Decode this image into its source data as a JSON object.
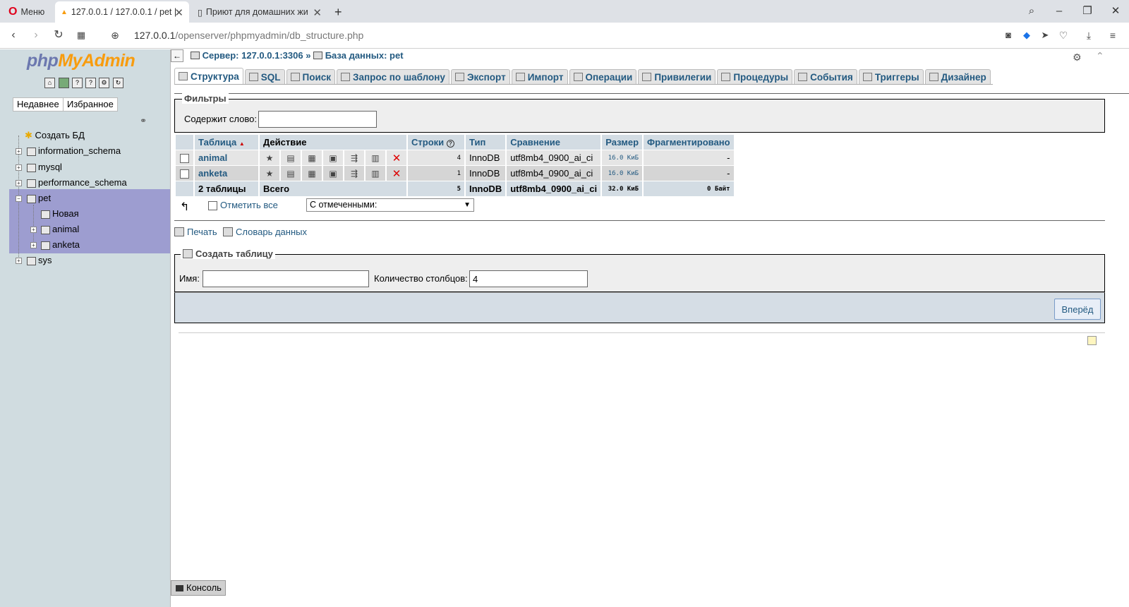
{
  "browser": {
    "menu_label": "Меню",
    "tabs": [
      {
        "title": "127.0.0.1 / 127.0.0.1 / pet |"
      },
      {
        "title": "Приют для домашних жи"
      }
    ],
    "url_host": "127.0.0.1",
    "url_path": "/openserver/phpmyadmin/db_structure.php"
  },
  "sidebar": {
    "logo_php": "php",
    "logo_myadmin": "MyAdmin",
    "recent_label": "Недавнее",
    "favorites_label": "Избранное",
    "tree": [
      {
        "label": "Создать БД"
      },
      {
        "label": "information_schema"
      },
      {
        "label": "mysql"
      },
      {
        "label": "performance_schema"
      },
      {
        "label": "pet"
      },
      {
        "label": "Новая"
      },
      {
        "label": "animal"
      },
      {
        "label": "anketa"
      },
      {
        "label": "sys"
      }
    ]
  },
  "breadcrumb": {
    "server": "Сервер: 127.0.0.1:3306",
    "sep": "»",
    "database": "База данных: pet"
  },
  "tabs": [
    {
      "label": "Структура"
    },
    {
      "label": "SQL"
    },
    {
      "label": "Поиск"
    },
    {
      "label": "Запрос по шаблону"
    },
    {
      "label": "Экспорт"
    },
    {
      "label": "Импорт"
    },
    {
      "label": "Операции"
    },
    {
      "label": "Привилегии"
    },
    {
      "label": "Процедуры"
    },
    {
      "label": "События"
    },
    {
      "label": "Триггеры"
    },
    {
      "label": "Дизайнер"
    }
  ],
  "filters": {
    "legend": "Фильтры",
    "contains_label": "Содержит слово:",
    "contains_value": ""
  },
  "table": {
    "headers": {
      "table": "Таблица",
      "action": "Действие",
      "rows": "Строки",
      "type": "Тип",
      "collation": "Сравнение",
      "size": "Размер",
      "overhead": "Фрагментировано"
    },
    "rows": [
      {
        "name": "animal",
        "rows": "4",
        "type": "InnoDB",
        "collation": "utf8mb4_0900_ai_ci",
        "size": "16.0 КиБ",
        "overhead": "-"
      },
      {
        "name": "anketa",
        "rows": "1",
        "type": "InnoDB",
        "collation": "utf8mb4_0900_ai_ci",
        "size": "16.0 КиБ",
        "overhead": "-"
      }
    ],
    "total": {
      "name": "2 таблицы",
      "label": "Всего",
      "rows": "5",
      "type": "InnoDB",
      "collation": "utf8mb4_0900_ai_ci",
      "size": "32.0 КиБ",
      "overhead": "0 Байт"
    },
    "check_all_label": "Отметить все",
    "with_selected": "С отмеченными:"
  },
  "links": {
    "print": "Печать",
    "dictionary": "Словарь данных"
  },
  "create_table": {
    "legend": "Создать таблицу",
    "name_label": "Имя:",
    "name_value": "",
    "cols_label": "Количество столбцов:",
    "cols_value": "4",
    "go_label": "Вперёд"
  },
  "console_label": "Консоль"
}
